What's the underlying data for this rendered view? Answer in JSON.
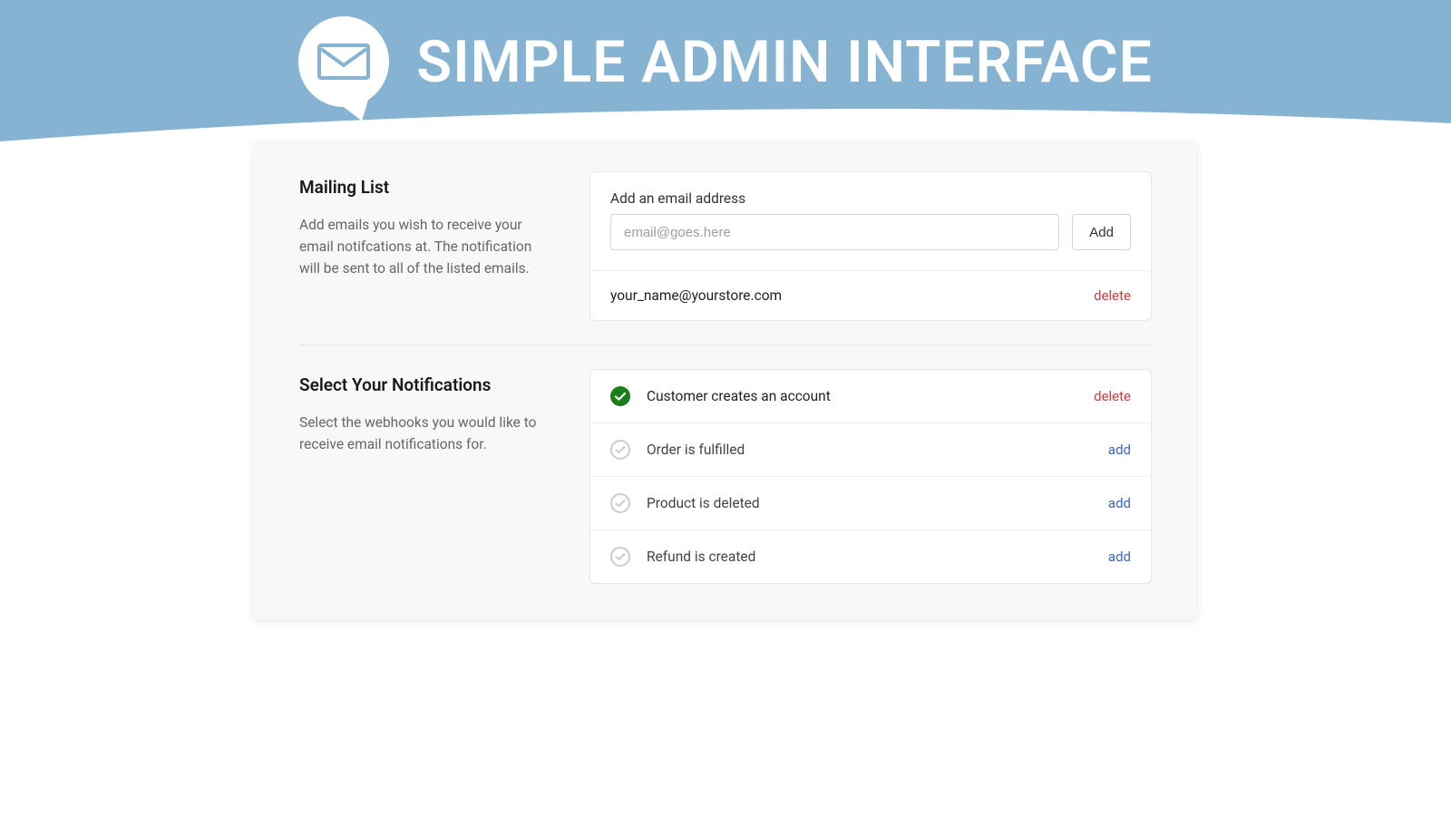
{
  "hero": {
    "title": "SIMPLE ADMIN INTERFACE"
  },
  "mailing": {
    "title": "Mailing List",
    "desc": "Add emails you wish to receive your email notifcations at. The notification will be sent to all of the listed emails.",
    "field_label": "Add an email address",
    "placeholder": "email@goes.here",
    "add_button": "Add",
    "emails": [
      {
        "address": "your_name@yourstore.com",
        "action": "delete"
      }
    ]
  },
  "notifications": {
    "title": "Select Your Notifications",
    "desc": "Select the webhooks you would like to receive email notifications for.",
    "items": [
      {
        "label": "Customer creates an account",
        "active": true,
        "action": "delete"
      },
      {
        "label": "Order is fulfilled",
        "active": false,
        "action": "add"
      },
      {
        "label": "Product is deleted",
        "active": false,
        "action": "add"
      },
      {
        "label": "Refund is created",
        "active": false,
        "action": "add"
      }
    ]
  },
  "colors": {
    "hero_bg": "#86b3d1",
    "delete": "#c83e3e",
    "add_link": "#3a66c7",
    "active_check": "#1a7f1a"
  }
}
